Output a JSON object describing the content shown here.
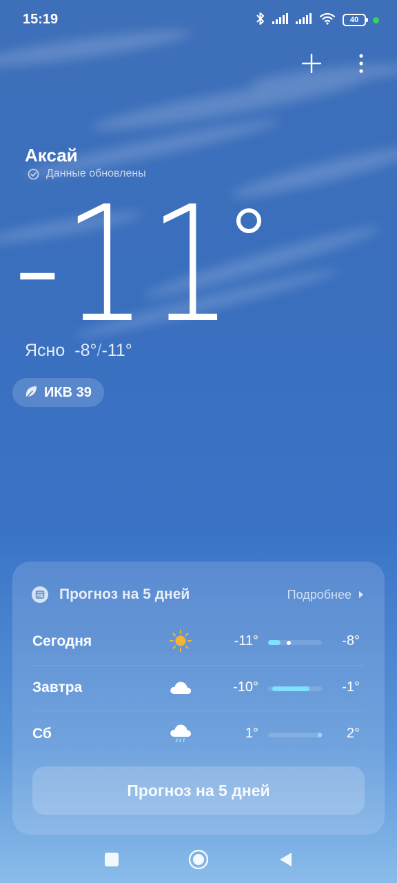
{
  "status_bar": {
    "time": "15:19",
    "battery": "40",
    "icons": [
      "bluetooth-icon",
      "signal-icon",
      "signal-icon",
      "wifi-icon",
      "battery-icon",
      "privacy-dot"
    ]
  },
  "actions": {
    "add_icon": "plus-icon",
    "menu_icon": "more-vertical-icon"
  },
  "location": {
    "city": "Аксай",
    "update_status": "Данные обновлены"
  },
  "current": {
    "temperature": "-11",
    "condition": "Ясно",
    "high": "-8°",
    "separator": "/",
    "low": "-11°"
  },
  "aqi": {
    "label": "ИКВ 39"
  },
  "forecast": {
    "title": "Прогноз на 5 дней",
    "more_label": "Подробнее",
    "range_min": -11,
    "range_max": 2,
    "rows": [
      {
        "day": "Сегодня",
        "icon": "sun-icon",
        "min_label": "-11°",
        "max_label": "-8°",
        "min": -11,
        "max": -8
      },
      {
        "day": "Завтра",
        "icon": "cloud-icon",
        "min_label": "-10°",
        "max_label": "-1°",
        "min": -10,
        "max": -1
      },
      {
        "day": "Сб",
        "icon": "rain-cloud-icon",
        "min_label": "1°",
        "max_label": "2°",
        "min": 1,
        "max": 2
      }
    ],
    "button_label": "Прогноз на 5 дней"
  },
  "colors": {
    "bar_fill": "#7fe0ff",
    "sun": "#f5b532",
    "privacy_dot": "#35d35a"
  }
}
